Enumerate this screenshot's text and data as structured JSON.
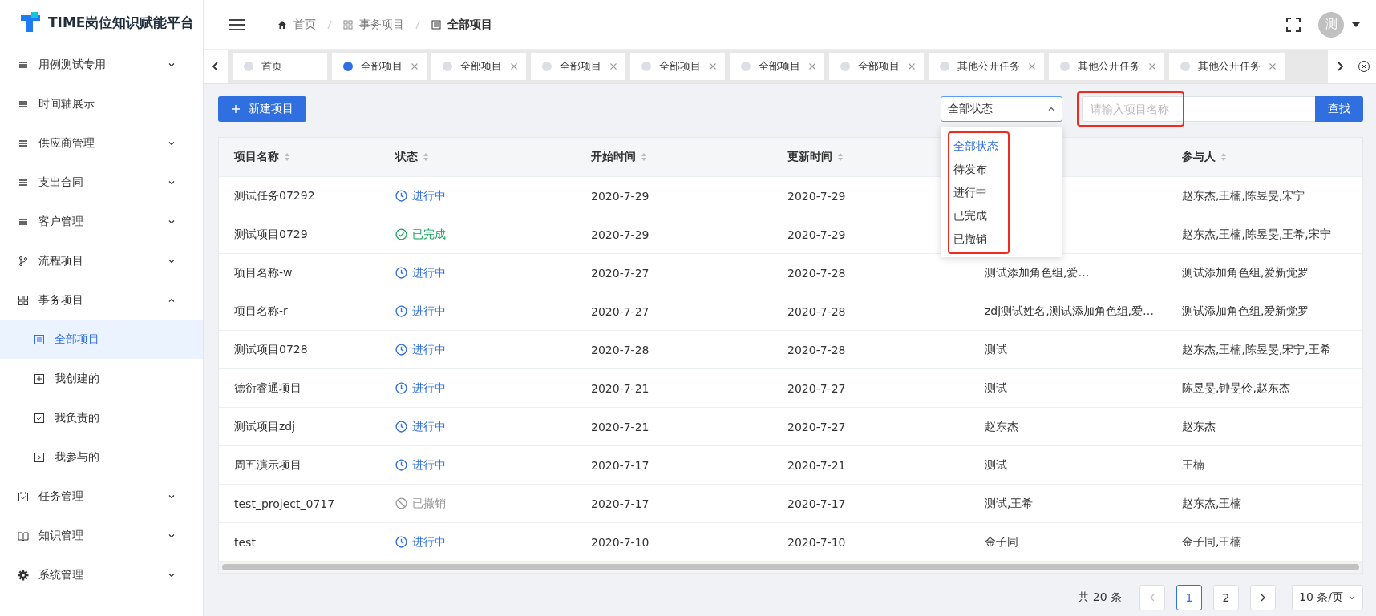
{
  "app": {
    "title": "TIME岗位知识赋能平台"
  },
  "sidebar": {
    "items": [
      {
        "label": "用例测试专用",
        "expanded": false
      },
      {
        "label": "时间轴展示"
      },
      {
        "label": "供应商管理",
        "expanded": false
      },
      {
        "label": "支出合同",
        "expanded": false
      },
      {
        "label": "客户管理",
        "expanded": false
      },
      {
        "label": "流程项目",
        "expanded": false
      },
      {
        "label": "事务项目",
        "expanded": true,
        "children": [
          {
            "label": "全部项目",
            "selected": true
          },
          {
            "label": "我创建的",
            "selected": false
          },
          {
            "label": "我负责的",
            "selected": false
          },
          {
            "label": "我参与的",
            "selected": false
          }
        ]
      },
      {
        "label": "任务管理",
        "expanded": false
      },
      {
        "label": "知识管理",
        "expanded": false
      },
      {
        "label": "系统管理",
        "expanded": false
      }
    ]
  },
  "breadcrumb": [
    "首页",
    "事务项目",
    "全部项目"
  ],
  "user": {
    "avatar": "测"
  },
  "tabs": [
    {
      "label": "首页",
      "selected": false,
      "closable": false
    },
    {
      "label": "全部项目",
      "selected": true,
      "closable": true
    },
    {
      "label": "全部项目",
      "selected": false,
      "closable": true
    },
    {
      "label": "全部项目",
      "selected": false,
      "closable": true
    },
    {
      "label": "全部项目",
      "selected": false,
      "closable": true
    },
    {
      "label": "全部项目",
      "selected": false,
      "closable": true
    },
    {
      "label": "全部项目",
      "selected": false,
      "closable": true
    },
    {
      "label": "其他公开任务",
      "selected": false,
      "closable": true
    },
    {
      "label": "其他公开任务",
      "selected": false,
      "closable": true
    },
    {
      "label": "其他公开任务",
      "selected": false,
      "closable": true
    }
  ],
  "toolbar": {
    "new_button": "新建项目",
    "status_select": {
      "value": "全部状态",
      "expanded": true,
      "options": [
        {
          "label": "全部状态",
          "selected": true
        },
        {
          "label": "待发布",
          "selected": false
        },
        {
          "label": "进行中",
          "selected": false
        },
        {
          "label": "已完成",
          "selected": false
        },
        {
          "label": "已撤销",
          "selected": false
        }
      ]
    },
    "search": {
      "placeholder": "请输入项目名称"
    },
    "search_button": "查找"
  },
  "table": {
    "columns": [
      "项目名称",
      "状态",
      "开始时间",
      "更新时间",
      "参与人"
    ],
    "rows": [
      {
        "name": "测试任务07292",
        "status": {
          "kind": "progress",
          "label": "进行中"
        },
        "start": "2020-7-29",
        "updated": "2020-7-29",
        "participants": "赵东杰,王楠,陈昱旻,宋宁"
      },
      {
        "name": "测试项目0729",
        "status": {
          "kind": "done",
          "label": "已完成"
        },
        "start": "2020-7-29",
        "updated": "2020-7-29",
        "participants": "赵东杰,王楠,陈昱旻,王希,宋宁"
      },
      {
        "name": "项目名称-w",
        "status": {
          "kind": "progress",
          "label": "进行中"
        },
        "start": "2020-7-27",
        "updated": "2020-7-28",
        "column_5": "测试添加角色组,爱…",
        "participants": "测试添加角色组,爱新觉罗"
      },
      {
        "name": "项目名称-r",
        "status": {
          "kind": "progress",
          "label": "进行中"
        },
        "start": "2020-7-27",
        "updated": "2020-7-28",
        "column_5": "zdj测试姓名,测试添加角色组,爱…",
        "participants": "测试添加角色组,爱新觉罗"
      },
      {
        "name": "测试项目0728",
        "status": {
          "kind": "progress",
          "label": "进行中"
        },
        "start": "2020-7-28",
        "updated": "2020-7-28",
        "column_5": "测试",
        "participants": "赵东杰,王楠,陈昱旻,宋宁,王希"
      },
      {
        "name": "德衍睿通项目",
        "status": {
          "kind": "progress",
          "label": "进行中"
        },
        "start": "2020-7-21",
        "updated": "2020-7-27",
        "column_5": "测试",
        "participants": "陈昱旻,钟旻伶,赵东杰"
      },
      {
        "name": "测试项目zdj",
        "status": {
          "kind": "progress",
          "label": "进行中"
        },
        "start": "2020-7-21",
        "updated": "2020-7-27",
        "column_5": "赵东杰",
        "participants": "赵东杰"
      },
      {
        "name": "周五演示项目",
        "status": {
          "kind": "progress",
          "label": "进行中"
        },
        "start": "2020-7-17",
        "updated": "2020-7-21",
        "column_5": "测试",
        "participants": "王楠"
      },
      {
        "name": "test_project_0717",
        "status": {
          "kind": "cancelled",
          "label": "已撤销"
        },
        "start": "2020-7-17",
        "updated": "2020-7-17",
        "column_5": "测试,王希",
        "participants": "赵东杰,王楠"
      },
      {
        "name": "test",
        "status": {
          "kind": "progress",
          "label": "进行中"
        },
        "start": "2020-7-10",
        "updated": "2020-7-10",
        "column_5": "金子同",
        "participants": "金子同,王楠"
      }
    ]
  },
  "pagination": {
    "total": "共 20 条",
    "pages": [
      {
        "label": "1",
        "selected": true
      },
      {
        "label": "2",
        "selected": false
      }
    ],
    "page_size": "10 条/页"
  }
}
